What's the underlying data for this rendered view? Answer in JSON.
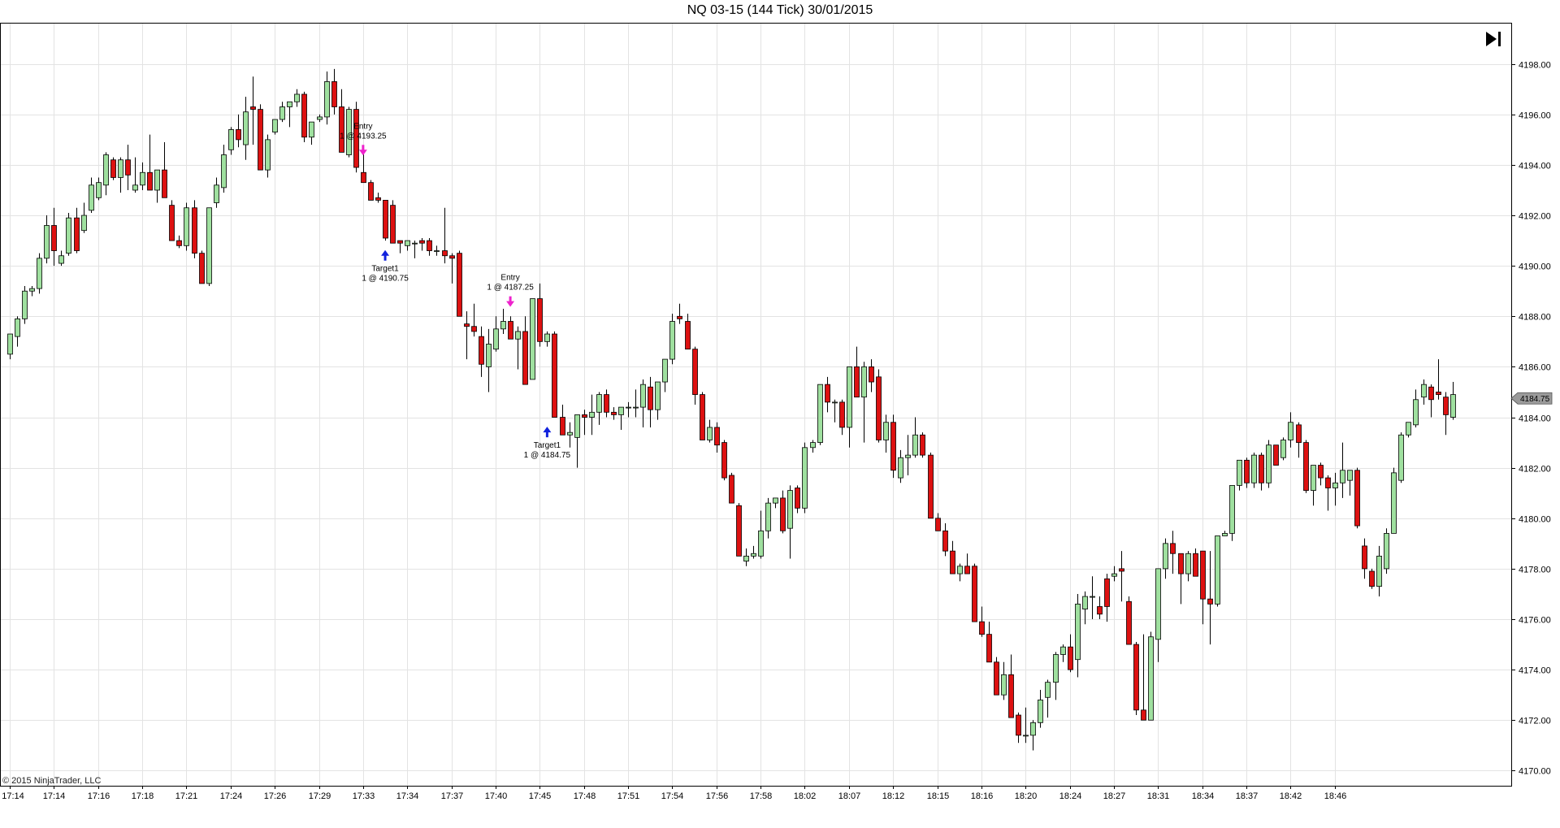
{
  "header": {
    "title": "NQ 03-15 (144 Tick)  30/01/2015"
  },
  "footer": {
    "copyright": "© 2015 NinjaTrader, LLC"
  },
  "controls": {
    "scroll_to_end_icon": "skip-to-end-icon"
  },
  "colors": {
    "up_fill": "#9fe09f",
    "down_fill": "#dd1111",
    "wick": "#000000",
    "grid": "#e3e3e3",
    "entry_arrow": "#ee22cc",
    "target_arrow": "#1122dd",
    "last_price_tag": "#9a9a9a"
  },
  "chart_data": {
    "type": "candlestick",
    "y_ticks": [
      "4170.00",
      "4172.00",
      "4174.00",
      "4176.00",
      "4178.00",
      "4180.00",
      "4182.00",
      "4184.00",
      "4186.00",
      "4188.00",
      "4190.00",
      "4192.00",
      "4194.00",
      "4196.00",
      "4198.00"
    ],
    "ylim": [
      4169.4,
      4199.6
    ],
    "grid": true,
    "last_price": "4184.75",
    "x_ticks": [
      {
        "bar": 0,
        "label": "17:14"
      },
      {
        "bar": 6,
        "label": "17:14"
      },
      {
        "bar": 12,
        "label": "17:16"
      },
      {
        "bar": 18,
        "label": "17:18"
      },
      {
        "bar": 24,
        "label": "17:21"
      },
      {
        "bar": 30,
        "label": "17:24"
      },
      {
        "bar": 36,
        "label": "17:26"
      },
      {
        "bar": 42,
        "label": "17:29"
      },
      {
        "bar": 48,
        "label": "17:33"
      },
      {
        "bar": 54,
        "label": "17:34"
      },
      {
        "bar": 60,
        "label": "17:37"
      },
      {
        "bar": 66,
        "label": "17:40"
      },
      {
        "bar": 72,
        "label": "17:45"
      },
      {
        "bar": 78,
        "label": "17:48"
      },
      {
        "bar": 84,
        "label": "17:51"
      },
      {
        "bar": 90,
        "label": "17:54"
      },
      {
        "bar": 96,
        "label": "17:56"
      },
      {
        "bar": 102,
        "label": "17:58"
      },
      {
        "bar": 108,
        "label": "18:02"
      },
      {
        "bar": 114,
        "label": "18:07"
      },
      {
        "bar": 120,
        "label": "18:12"
      },
      {
        "bar": 126,
        "label": "18:15"
      },
      {
        "bar": 132,
        "label": "18:16"
      },
      {
        "bar": 138,
        "label": "18:20"
      },
      {
        "bar": 144,
        "label": "18:24"
      },
      {
        "bar": 150,
        "label": "18:27"
      },
      {
        "bar": 156,
        "label": "18:31"
      },
      {
        "bar": 162,
        "label": "18:34"
      },
      {
        "bar": 168,
        "label": "18:37"
      },
      {
        "bar": 174,
        "label": "18:42"
      },
      {
        "bar": 180,
        "label": "18:46"
      }
    ],
    "candles": [
      [
        4186.5,
        4187.3,
        4186.3,
        4187.3
      ],
      [
        4187.2,
        4188.0,
        4186.8,
        4187.9
      ],
      [
        4187.9,
        4189.2,
        4187.7,
        4189.0
      ],
      [
        4189.0,
        4189.2,
        4188.8,
        4189.1
      ],
      [
        4189.1,
        4190.5,
        4188.9,
        4190.3
      ],
      [
        4190.3,
        4192.0,
        4190.1,
        4191.6
      ],
      [
        4191.6,
        4192.3,
        4190.0,
        4190.6
      ],
      [
        4190.1,
        4190.6,
        4190.0,
        4190.4
      ],
      [
        4190.5,
        4192.1,
        4190.4,
        4191.9
      ],
      [
        4191.9,
        4192.3,
        4190.5,
        4190.6
      ],
      [
        4191.4,
        4192.5,
        4191.3,
        4192.0
      ],
      [
        4192.2,
        4193.5,
        4192.1,
        4193.2
      ],
      [
        4192.7,
        4193.5,
        4192.6,
        4193.3
      ],
      [
        4193.2,
        4194.5,
        4192.8,
        4194.4
      ],
      [
        4194.2,
        4194.3,
        4193.4,
        4193.5
      ],
      [
        4193.5,
        4194.3,
        4192.9,
        4194.2
      ],
      [
        4194.2,
        4194.8,
        4193.0,
        4193.6
      ],
      [
        4193.0,
        4194.3,
        4192.9,
        4193.2
      ],
      [
        4193.2,
        4194.1,
        4193.0,
        4193.7
      ],
      [
        4193.7,
        4195.2,
        4193.2,
        4193.0
      ],
      [
        4193.0,
        4193.8,
        4192.5,
        4193.8
      ],
      [
        4193.8,
        4194.9,
        4193.1,
        4192.7
      ],
      [
        4192.4,
        4192.6,
        4191.0,
        4191.0
      ],
      [
        4191.0,
        4191.2,
        4190.7,
        4190.8
      ],
      [
        4190.8,
        4192.5,
        4190.6,
        4192.3
      ],
      [
        4192.3,
        4192.6,
        4190.3,
        4190.5
      ],
      [
        4190.5,
        4190.6,
        4189.3,
        4189.3
      ],
      [
        4189.3,
        4192.3,
        4189.2,
        4192.3
      ],
      [
        4192.5,
        4193.5,
        4192.3,
        4193.2
      ],
      [
        4193.1,
        4194.8,
        4192.9,
        4194.4
      ],
      [
        4194.6,
        4195.5,
        4194.4,
        4195.4
      ],
      [
        4195.4,
        4196.0,
        4194.7,
        4195.0
      ],
      [
        4194.8,
        4196.7,
        4194.2,
        4196.1
      ],
      [
        4196.3,
        4197.5,
        4194.8,
        4196.2
      ],
      [
        4196.2,
        4196.4,
        4193.8,
        4193.8
      ],
      [
        4193.8,
        4195.2,
        4193.5,
        4195.0
      ],
      [
        4195.3,
        4195.8,
        4195.2,
        4195.8
      ],
      [
        4195.8,
        4196.5,
        4195.7,
        4196.3
      ],
      [
        4196.3,
        4196.5,
        4195.5,
        4196.5
      ],
      [
        4196.5,
        4197.0,
        4196.3,
        4196.8
      ],
      [
        4196.8,
        4196.9,
        4194.9,
        4195.1
      ],
      [
        4195.1,
        4195.2,
        4194.8,
        4195.7
      ],
      [
        4195.8,
        4196.0,
        4195.7,
        4195.9
      ],
      [
        4195.9,
        4197.7,
        4195.6,
        4197.3
      ],
      [
        4197.3,
        4197.8,
        4196.0,
        4196.3
      ],
      [
        4196.3,
        4197.0,
        4194.5,
        4194.5
      ],
      [
        4194.4,
        4196.3,
        4194.3,
        4196.2
      ],
      [
        4196.2,
        4196.5,
        4193.7,
        4193.9
      ],
      [
        4193.7,
        4194.5,
        4193.3,
        4193.3
      ],
      [
        4193.3,
        4193.4,
        4192.8,
        4192.6
      ],
      [
        4192.7,
        4192.9,
        4192.5,
        4192.6
      ],
      [
        4192.6,
        4192.6,
        4191.0,
        4191.1
      ],
      [
        4192.4,
        4192.6,
        4191.0,
        4190.9
      ],
      [
        4191.0,
        4191.0,
        4190.5,
        4190.9
      ],
      [
        4190.8,
        4191.0,
        4190.6,
        4191.0
      ],
      [
        4190.9,
        4191.0,
        4190.3,
        4190.9
      ],
      [
        4191.0,
        4191.1,
        4190.6,
        4190.9
      ],
      [
        4191.0,
        4191.1,
        4190.4,
        4190.6
      ],
      [
        4190.6,
        4190.8,
        4190.4,
        4190.6
      ],
      [
        4190.6,
        4192.3,
        4190.1,
        4190.4
      ],
      [
        4190.4,
        4190.5,
        4189.3,
        4190.3
      ],
      [
        4190.5,
        4190.6,
        4188.4,
        4188.0
      ],
      [
        4187.7,
        4188.2,
        4186.3,
        4187.6
      ],
      [
        4187.6,
        4188.5,
        4187.2,
        4187.4
      ],
      [
        4187.2,
        4187.6,
        4185.6,
        4186.1
      ],
      [
        4186.0,
        4187.5,
        4185.0,
        4186.9
      ],
      [
        4186.7,
        4188.0,
        4186.6,
        4187.5
      ],
      [
        4187.5,
        4188.3,
        4187.3,
        4187.8
      ],
      [
        4187.8,
        4188.0,
        4187.1,
        4187.1
      ],
      [
        4187.1,
        4187.6,
        4185.9,
        4187.4
      ],
      [
        4187.4,
        4188.0,
        4185.4,
        4185.3
      ],
      [
        4185.5,
        4188.7,
        4185.5,
        4188.7
      ],
      [
        4188.7,
        4189.3,
        4186.8,
        4187.0
      ],
      [
        4187.0,
        4187.4,
        4186.8,
        4187.3
      ],
      [
        4187.3,
        4187.4,
        4184.0,
        4184.0
      ],
      [
        4184.0,
        4184.5,
        4183.4,
        4183.3
      ],
      [
        4183.3,
        4183.8,
        4182.8,
        4183.4
      ],
      [
        4183.2,
        4184.1,
        4182.0,
        4184.1
      ],
      [
        4184.1,
        4184.3,
        4183.3,
        4184.0
      ],
      [
        4184.0,
        4184.9,
        4183.3,
        4184.2
      ],
      [
        4184.2,
        4185.0,
        4183.7,
        4184.9
      ],
      [
        4184.9,
        4185.1,
        4184.0,
        4184.2
      ],
      [
        4184.2,
        4184.4,
        4183.9,
        4184.1
      ],
      [
        4184.1,
        4184.4,
        4183.5,
        4184.4
      ],
      [
        4184.4,
        4184.6,
        4184.0,
        4184.4
      ],
      [
        4184.4,
        4185.1,
        4184.0,
        4184.4
      ],
      [
        4184.4,
        4185.5,
        4183.6,
        4185.3
      ],
      [
        4185.2,
        4185.6,
        4183.6,
        4184.3
      ],
      [
        4184.3,
        4185.4,
        4183.9,
        4185.4
      ],
      [
        4185.4,
        4186.3,
        4185.0,
        4186.3
      ],
      [
        4186.3,
        4188.1,
        4186.1,
        4187.8
      ],
      [
        4188.0,
        4188.5,
        4187.7,
        4187.9
      ],
      [
        4187.8,
        4188.1,
        4186.7,
        4186.7
      ],
      [
        4186.7,
        4186.8,
        4184.5,
        4184.9
      ],
      [
        4184.9,
        4185.0,
        4183.1,
        4183.1
      ],
      [
        4183.1,
        4183.9,
        4183.0,
        4183.6
      ],
      [
        4183.6,
        4183.8,
        4182.6,
        4182.9
      ],
      [
        4183.0,
        4183.1,
        4181.5,
        4181.6
      ],
      [
        4181.7,
        4181.8,
        4180.6,
        4180.6
      ],
      [
        4180.5,
        4180.6,
        4178.5,
        4178.5
      ],
      [
        4178.3,
        4178.8,
        4178.1,
        4178.5
      ],
      [
        4178.5,
        4178.9,
        4178.4,
        4178.6
      ],
      [
        4178.5,
        4180.3,
        4178.4,
        4179.5
      ],
      [
        4179.5,
        4180.8,
        4179.2,
        4180.6
      ],
      [
        4180.6,
        4180.8,
        4180.4,
        4180.8
      ],
      [
        4180.8,
        4181.1,
        4179.4,
        4179.5
      ],
      [
        4179.6,
        4181.3,
        4178.4,
        4181.1
      ],
      [
        4181.2,
        4181.3,
        4180.2,
        4180.4
      ],
      [
        4180.4,
        4183.0,
        4180.2,
        4182.8
      ],
      [
        4182.8,
        4183.1,
        4182.6,
        4183.0
      ],
      [
        4183.0,
        4185.3,
        4182.9,
        4185.3
      ],
      [
        4185.3,
        4185.6,
        4184.2,
        4184.6
      ],
      [
        4184.6,
        4184.7,
        4183.8,
        4184.6
      ],
      [
        4184.6,
        4184.7,
        4183.3,
        4183.6
      ],
      [
        4183.6,
        4186.0,
        4182.8,
        4186.0
      ],
      [
        4186.0,
        4186.8,
        4185.6,
        4184.8
      ],
      [
        4184.8,
        4186.2,
        4183.0,
        4186.0
      ],
      [
        4186.0,
        4186.3,
        4185.0,
        4185.4
      ],
      [
        4185.6,
        4185.9,
        4183.0,
        4183.1
      ],
      [
        4183.1,
        4184.1,
        4182.6,
        4183.8
      ],
      [
        4183.8,
        4184.1,
        4181.6,
        4181.9
      ],
      [
        4181.6,
        4182.7,
        4181.4,
        4182.4
      ],
      [
        4182.4,
        4183.3,
        4181.7,
        4182.5
      ],
      [
        4182.5,
        4184.0,
        4182.4,
        4183.3
      ],
      [
        4183.3,
        4183.4,
        4182.4,
        4182.5
      ],
      [
        4182.5,
        4182.6,
        4180.0,
        4180.0
      ],
      [
        4180.0,
        4180.2,
        4179.5,
        4179.5
      ],
      [
        4179.5,
        4179.8,
        4178.5,
        4178.7
      ],
      [
        4178.7,
        4179.1,
        4177.8,
        4177.8
      ],
      [
        4177.8,
        4178.2,
        4177.5,
        4178.1
      ],
      [
        4178.1,
        4178.6,
        4177.8,
        4177.8
      ],
      [
        4178.1,
        4178.2,
        4175.9,
        4175.9
      ],
      [
        4175.9,
        4176.5,
        4175.3,
        4175.4
      ],
      [
        4175.4,
        4175.9,
        4174.3,
        4174.3
      ],
      [
        4174.3,
        4174.5,
        4173.0,
        4173.0
      ],
      [
        4173.0,
        4174.3,
        4172.8,
        4173.8
      ],
      [
        4173.8,
        4174.6,
        4172.1,
        4172.1
      ],
      [
        4172.2,
        4172.3,
        4171.1,
        4171.4
      ],
      [
        4171.4,
        4172.5,
        4171.1,
        4171.4
      ],
      [
        4171.4,
        4172.0,
        4170.8,
        4171.9
      ],
      [
        4171.9,
        4173.2,
        4171.7,
        4172.8
      ],
      [
        4172.9,
        4173.6,
        4172.1,
        4173.5
      ],
      [
        4173.5,
        4174.7,
        4172.8,
        4174.6
      ],
      [
        4174.6,
        4175.0,
        4174.3,
        4174.9
      ],
      [
        4174.9,
        4175.4,
        4173.9,
        4174.0
      ],
      [
        4174.4,
        4177.0,
        4173.7,
        4176.6
      ],
      [
        4176.4,
        4177.1,
        4175.8,
        4176.9
      ],
      [
        4176.9,
        4177.7,
        4176.0,
        4176.9
      ],
      [
        4176.5,
        4176.9,
        4176.0,
        4176.2
      ],
      [
        4177.6,
        4177.8,
        4175.9,
        4176.5
      ],
      [
        4177.7,
        4178.1,
        4177.5,
        4177.8
      ],
      [
        4178.0,
        4178.7,
        4176.7,
        4177.9
      ],
      [
        4176.7,
        4176.9,
        4175.0,
        4175.0
      ],
      [
        4175.0,
        4175.1,
        4172.2,
        4172.4
      ],
      [
        4172.4,
        4175.4,
        4172.0,
        4172.0
      ],
      [
        4172.0,
        4175.5,
        4172.0,
        4175.3
      ],
      [
        4175.2,
        4175.3,
        4174.3,
        4178.0
      ],
      [
        4178.0,
        4179.2,
        4177.6,
        4179.0
      ],
      [
        4179.0,
        4179.5,
        4177.8,
        4178.6
      ],
      [
        4178.6,
        4178.6,
        4176.6,
        4177.8
      ],
      [
        4177.8,
        4178.7,
        4177.5,
        4178.6
      ],
      [
        4178.6,
        4178.8,
        4177.8,
        4177.7
      ],
      [
        4178.7,
        4178.7,
        4175.8,
        4176.8
      ],
      [
        4176.8,
        4178.7,
        4175.0,
        4176.6
      ],
      [
        4176.6,
        4178.8,
        4176.5,
        4179.3
      ],
      [
        4179.3,
        4179.5,
        4179.3,
        4179.4
      ],
      [
        4179.4,
        4181.3,
        4179.1,
        4181.3
      ],
      [
        4181.3,
        4182.3,
        4181.1,
        4182.3
      ],
      [
        4182.3,
        4182.4,
        4181.2,
        4181.4
      ],
      [
        4181.4,
        4182.6,
        4181.2,
        4182.5
      ],
      [
        4182.5,
        4182.6,
        4181.1,
        4181.4
      ],
      [
        4181.4,
        4183.1,
        4181.2,
        4182.9
      ],
      [
        4182.9,
        4182.9,
        4182.2,
        4182.1
      ],
      [
        4182.4,
        4183.2,
        4182.3,
        4183.1
      ],
      [
        4183.1,
        4184.2,
        4182.8,
        4183.8
      ],
      [
        4183.7,
        4183.8,
        4182.4,
        4183.0
      ],
      [
        4183.0,
        4183.1,
        4181.0,
        4181.1
      ],
      [
        4181.1,
        4182.1,
        4180.5,
        4182.1
      ],
      [
        4182.1,
        4182.2,
        4181.3,
        4181.6
      ],
      [
        4181.6,
        4181.7,
        4180.3,
        4181.2
      ],
      [
        4181.2,
        4181.8,
        4180.5,
        4181.4
      ],
      [
        4181.4,
        4183.0,
        4180.8,
        4181.9
      ],
      [
        4181.5,
        4181.8,
        4180.9,
        4181.9
      ],
      [
        4181.9,
        4182.0,
        4179.6,
        4179.7
      ],
      [
        4178.9,
        4179.2,
        4177.6,
        4178.0
      ],
      [
        4177.9,
        4178.0,
        4177.2,
        4177.3
      ],
      [
        4177.3,
        4178.9,
        4176.9,
        4178.5
      ],
      [
        4178.0,
        4179.6,
        4177.8,
        4179.4
      ],
      [
        4179.4,
        4182.0,
        4179.4,
        4181.8
      ],
      [
        4181.5,
        4183.4,
        4181.4,
        4183.3
      ],
      [
        4183.3,
        4183.8,
        4183.2,
        4183.8
      ],
      [
        4183.7,
        4185.1,
        4183.6,
        4184.7
      ],
      [
        4184.8,
        4185.5,
        4184.5,
        4185.3
      ],
      [
        4185.2,
        4185.3,
        4184.0,
        4184.7
      ],
      [
        4185.0,
        4186.3,
        4184.7,
        4184.9
      ],
      [
        4184.8,
        4185.0,
        4183.3,
        4184.1
      ],
      [
        4184.0,
        4185.4,
        4183.9,
        4184.9
      ]
    ],
    "trade_markers": [
      {
        "bar": 48,
        "kind": "entry",
        "direction": "short",
        "price": 4194.6,
        "label_line1": "Entry",
        "label_line2": "1 @ 4193.25"
      },
      {
        "bar": 51,
        "kind": "target",
        "direction": "cover",
        "price": 4190.4,
        "label_line1": "Target1",
        "label_line2": "1 @ 4190.75"
      },
      {
        "bar": 68,
        "kind": "entry",
        "direction": "short",
        "price": 4188.6,
        "label_line1": "Entry",
        "label_line2": "1 @ 4187.25"
      },
      {
        "bar": 73,
        "kind": "target",
        "direction": "cover",
        "price": 4183.4,
        "label_line1": "Target1",
        "label_line2": "1 @ 4184.75"
      }
    ]
  }
}
